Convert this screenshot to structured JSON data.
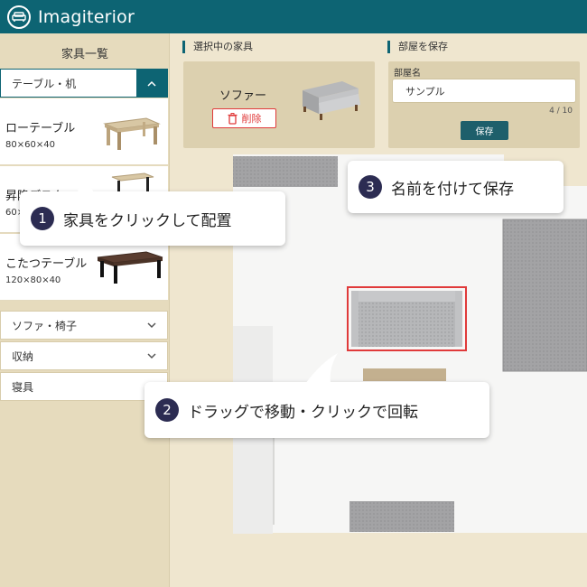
{
  "app": {
    "title": "Imagiterior",
    "logo_icon": "sofa-icon"
  },
  "sidebar": {
    "title": "家具一覧",
    "open_category": {
      "label": "テーブル・机",
      "icon": "chevron-up-icon"
    },
    "items": [
      {
        "name": "ローテーブル",
        "size": "80×60×40"
      },
      {
        "name": "昇降デスク",
        "size": "60×"
      },
      {
        "name": "こたつテーブル",
        "size": "120×80×40"
      }
    ],
    "categories": [
      {
        "label": "ソファ・椅子",
        "icon": "chevron-down-icon"
      },
      {
        "label": "収納",
        "icon": "chevron-down-icon"
      },
      {
        "label": "寝具",
        "icon": ""
      }
    ]
  },
  "selected": {
    "title": "選択中の家具",
    "name": "ソファー",
    "delete_label": "削除",
    "delete_icon": "trash-icon"
  },
  "save_room": {
    "title": "部屋を保存",
    "field_label": "部屋名",
    "value": "サンプル",
    "counter": "4 / 10",
    "save_label": "保存"
  },
  "tips": [
    {
      "num": "1",
      "text": "家具をクリックして配置"
    },
    {
      "num": "2",
      "text": "ドラッグで移動・クリックで回転"
    },
    {
      "num": "3",
      "text": "名前を付けて保存"
    }
  ],
  "colors": {
    "header": "#0d6473",
    "accent": "#0d6473",
    "delete": "#e03a3a",
    "selection": "#e03a3a",
    "badge": "#2c2c52"
  }
}
